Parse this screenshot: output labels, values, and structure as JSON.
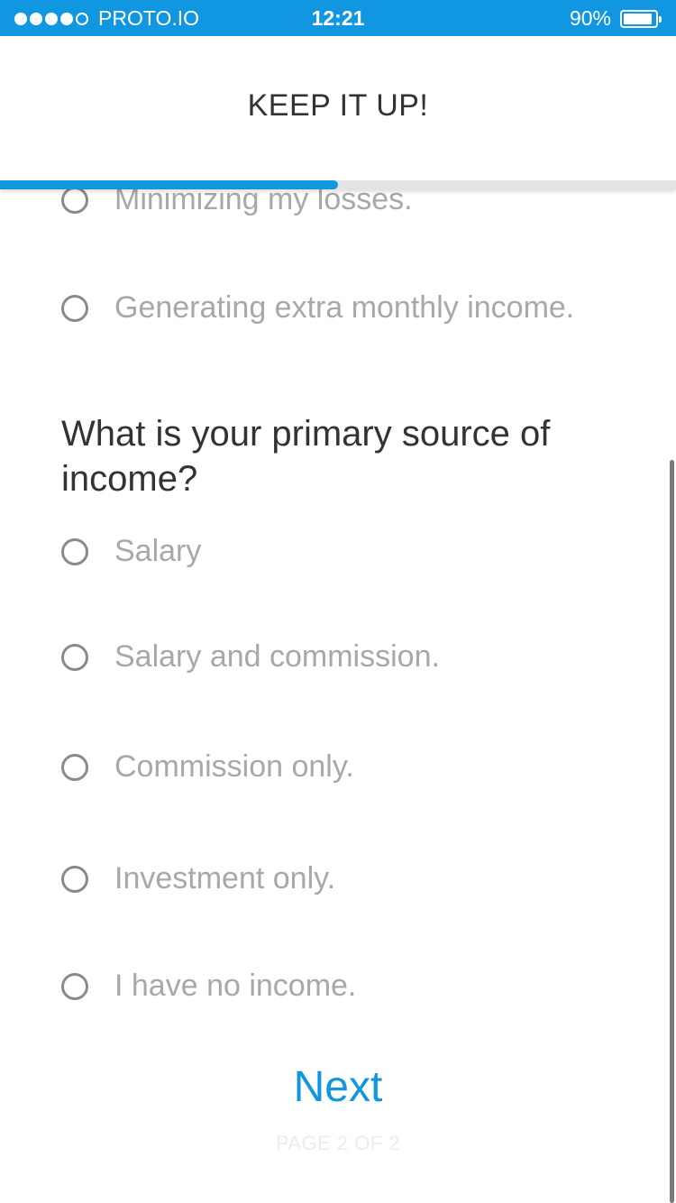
{
  "status_bar": {
    "carrier": "PROTO.IO",
    "time": "12:21",
    "battery": "90%",
    "battery_level": 0.9,
    "signal_bars": 4,
    "signal_max": 5
  },
  "header": {
    "title": "KEEP IT UP!",
    "progress": 0.5,
    "progress_color": "#1196e1"
  },
  "previous_question": {
    "options": [
      {
        "label": "Minimizing my losses."
      },
      {
        "label": "Generating extra monthly income."
      }
    ]
  },
  "question": {
    "text": "What is your primary source of income?",
    "options": [
      {
        "label": "Salary",
        "selected": false
      },
      {
        "label": "Salary and commission.",
        "selected": false
      },
      {
        "label": "Commission only.",
        "selected": false
      },
      {
        "label": "Investment only.",
        "selected": false
      },
      {
        "label": "I have no income.",
        "selected": false
      }
    ]
  },
  "footer": {
    "next_label": "Next",
    "page_indicator": "PAGE 2 OF 2"
  }
}
